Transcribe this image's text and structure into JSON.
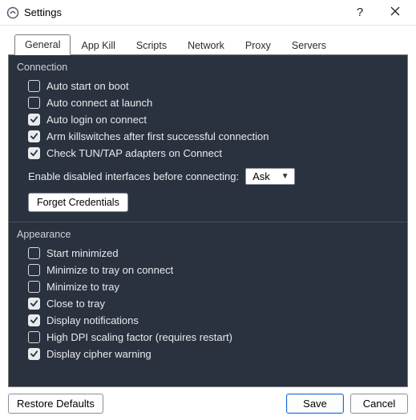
{
  "window": {
    "title": "Settings"
  },
  "tabs": [
    {
      "label": "General"
    },
    {
      "label": "App Kill"
    },
    {
      "label": "Scripts"
    },
    {
      "label": "Network"
    },
    {
      "label": "Proxy"
    },
    {
      "label": "Servers"
    }
  ],
  "connection": {
    "title": "Connection",
    "items": [
      {
        "label": "Auto start on boot",
        "checked": false
      },
      {
        "label": "Auto connect at launch",
        "checked": false
      },
      {
        "label": "Auto login on connect",
        "checked": true
      },
      {
        "label": "Arm killswitches after first successful connection",
        "checked": true
      },
      {
        "label": "Check TUN/TAP adapters on Connect",
        "checked": true
      }
    ],
    "enable_label": "Enable disabled interfaces before connecting:",
    "enable_value": "Ask",
    "forget_label": "Forget Credentials"
  },
  "appearance": {
    "title": "Appearance",
    "items": [
      {
        "label": "Start minimized",
        "checked": false
      },
      {
        "label": "Minimize to tray on connect",
        "checked": false
      },
      {
        "label": "Minimize to tray",
        "checked": false
      },
      {
        "label": "Close to tray",
        "checked": true
      },
      {
        "label": "Display notifications",
        "checked": true
      },
      {
        "label": "High DPI scaling factor (requires restart)",
        "checked": false
      },
      {
        "label": "Display cipher warning",
        "checked": true
      }
    ]
  },
  "footer": {
    "restore": "Restore Defaults",
    "save": "Save",
    "cancel": "Cancel"
  }
}
